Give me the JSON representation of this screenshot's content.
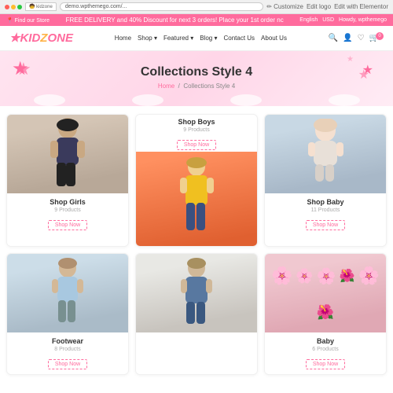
{
  "browser": {
    "url": "demo.wpthemego.com/...",
    "tabs": [
      "Kz kidzone",
      "Customize",
      "Edit logo",
      "Edit with Elementor"
    ]
  },
  "topbar": {
    "promo": "FREE DELIVERY and 40% Discount for next 3 orders! Place your 1st order nc",
    "lang": "English",
    "currency": "USD"
  },
  "navbar": {
    "logo": "KIDZONE",
    "links": [
      "Home",
      "Shop",
      "Featured",
      "Blog",
      "Contact Us",
      "About Us"
    ],
    "cart_count": "0"
  },
  "hero": {
    "title": "Collections Style 4",
    "breadcrumb_home": "Home",
    "breadcrumb_current": "Collections Style 4"
  },
  "collections": [
    {
      "id": "girls",
      "title": "Shop Girls",
      "products": "9 Products",
      "btn": "Shop Now",
      "img_type": "girl"
    },
    {
      "id": "boys",
      "title": "Shop Boys",
      "products": "9 Products",
      "btn": "Shop Now",
      "img_type": "boy"
    },
    {
      "id": "baby",
      "title": "Shop Baby",
      "products": "11 Products",
      "btn": "Shop Now",
      "img_type": "baby"
    },
    {
      "id": "footwear",
      "title": "Footwear",
      "products": "8 Products",
      "btn": "Shop Now",
      "img_type": "footwear"
    },
    {
      "id": "baby2",
      "title": "",
      "products": "",
      "btn": "",
      "img_type": "overalls"
    },
    {
      "id": "baby3",
      "title": "Baby",
      "products": "6 Products",
      "btn": "Shop Now",
      "img_type": "flowers"
    }
  ]
}
